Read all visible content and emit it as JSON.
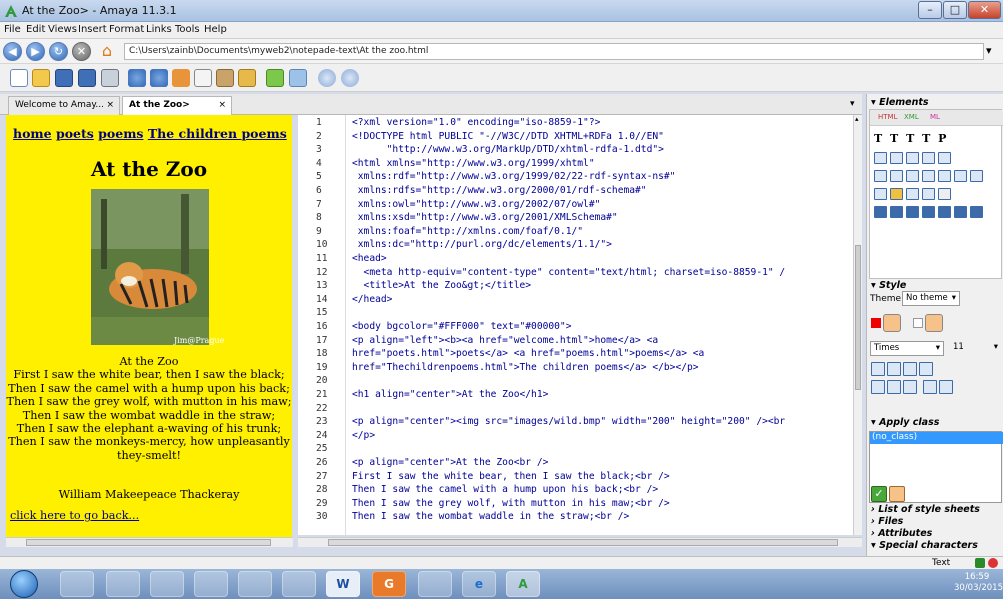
{
  "window": {
    "title": "At the Zoo> - Amaya 11.3.1",
    "buttons": {
      "minimize": "–",
      "maximize": "□",
      "close": "✕"
    }
  },
  "menu": [
    "File",
    "Edit",
    "Views",
    "Insert",
    "Format",
    "Links",
    "Tools",
    "Help"
  ],
  "address": {
    "url": "C:\\Users\\zainb\\Documents\\myweb2\\notepade-text\\At the zoo.html",
    "back_glyph": "◀",
    "forward_glyph": "▶",
    "reload_glyph": "↻",
    "stop_glyph": "✕",
    "home_glyph": "⌂",
    "dropdown_glyph": "▾"
  },
  "tabs": [
    {
      "label": "Welcome to Amay...",
      "close": "×"
    },
    {
      "label": "At the Zoo>",
      "close": "×"
    }
  ],
  "preview": {
    "links": [
      "home",
      "poets",
      "poems",
      "The children poems"
    ],
    "heading": "At the Zoo",
    "image_credit": "Jim@Prague",
    "poem_lines": [
      "At the Zoo",
      "First I saw the white bear, then I saw the black;",
      "Then I saw the camel with a hump upon his back;",
      "Then I saw the grey wolf, with mutton in his maw;",
      "Then I saw the wombat waddle in the straw;",
      "Then I saw the elephant a-waving of his trunk;",
      "Then I saw the monkeys-mercy, how unpleasantly",
      "they-smelt!"
    ],
    "author": "William Makeepeace Thackeray",
    "back_link": "click here to go back...",
    "background_color": "#FFF000"
  },
  "code": {
    "line_numbers": [
      "1",
      "2",
      "3",
      "4",
      "5",
      "6",
      "7",
      "8",
      "9",
      "10",
      "11",
      "12",
      "13",
      "14",
      "15",
      "16",
      "17",
      "18",
      "19",
      "20",
      "21",
      "22",
      "23",
      "24",
      "25",
      "26",
      "27",
      "28",
      "29",
      "30"
    ],
    "lines": [
      "<?xml version=\"1.0\" encoding=\"iso-8859-1\"?>",
      "<!DOCTYPE html PUBLIC \"-//W3C//DTD XHTML+RDFa 1.0//EN\"",
      "      \"http://www.w3.org/MarkUp/DTD/xhtml-rdfa-1.dtd\">",
      "<html xmlns=\"http://www.w3.org/1999/xhtml\"",
      " xmlns:rdf=\"http://www.w3.org/1999/02/22-rdf-syntax-ns#\"",
      " xmlns:rdfs=\"http://www.w3.org/2000/01/rdf-schema#\"",
      " xmlns:owl=\"http://www.w3.org/2002/07/owl#\"",
      " xmlns:xsd=\"http://www.w3.org/2001/XMLSchema#\"",
      " xmlns:foaf=\"http://xmlns.com/foaf/0.1/\"",
      " xmlns:dc=\"http://purl.org/dc/elements/1.1/\">",
      "<head>",
      "  <meta http-equiv=\"content-type\" content=\"text/html; charset=iso-8859-1\" /",
      "  <title>At the Zoo&gt;</title>",
      "</head>",
      "",
      "<body bgcolor=\"#FFF000\" text=\"#00000\">",
      "<p align=\"left\"><b><a href=\"welcome.html\">home</a> <a",
      "href=\"poets.html\">poets</a> <a href=\"poems.html\">poems</a> <a",
      "href=\"Thechildrenpoems.html\">The children poems</a> </b></p>",
      "",
      "<h1 align=\"center\">At the Zoo</h1>",
      "",
      "<p align=\"center\"><img src=\"images/wild.bmp\" width=\"200\" height=\"200\" /><br",
      "</p>",
      "",
      "<p align=\"center\">At the Zoo<br />",
      "First I saw the white bear, then I saw the black;<br />",
      "Then I saw the camel with a hump upon his back;<br />",
      "Then I saw the grey wolf, with mutton in his maw;<br />",
      "Then I saw the wombat waddle in the straw;<br />"
    ]
  },
  "panel": {
    "elements_header": "Elements",
    "style_header": "Style",
    "theme_label": "Theme",
    "theme_value": "No theme",
    "font_value": "Times",
    "size_value": "11",
    "apply_class_header": "Apply class",
    "class_item": "(no_class)",
    "sections": [
      "List of style sheets",
      "Files",
      "Attributes",
      "Special characters"
    ],
    "text_formats": [
      "T",
      "T",
      "T",
      "T",
      "P"
    ],
    "panel_tab_labels": [
      "HTML",
      "XML",
      "ML"
    ]
  },
  "status": {
    "mode": "Text"
  },
  "taskbar": {
    "time": "16:59",
    "date": "30/03/2015",
    "app_glyphs": [
      "W",
      "G",
      "A"
    ]
  }
}
